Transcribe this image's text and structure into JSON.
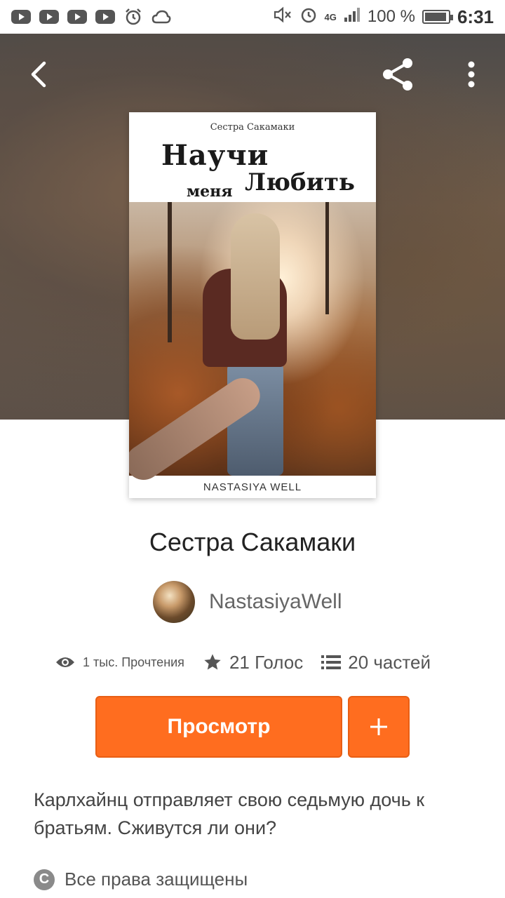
{
  "status_bar": {
    "battery": "100 %",
    "network": "4G",
    "time": "6:31"
  },
  "header": {
    "back_icon": "chevron-left-icon",
    "share_icon": "share-icon",
    "more_icon": "more-vertical-icon"
  },
  "cover": {
    "series": "Сестра Сакамаки",
    "title_line1": "Научи",
    "title_small": "меня",
    "title_line2": "Любить",
    "author": "NASTASIYA WELL"
  },
  "story": {
    "title": "Сестра Сакамаки",
    "author": "NastasiyaWell",
    "stats": {
      "reads": "1 тыс. Прочтения",
      "votes": "21 Голос",
      "parts": "20 частей"
    },
    "read_button": "Просмотр",
    "add_button_icon": "plus-icon",
    "description": "Карлхайнц отправляет свою седьмую дочь к братьям. Сживутся ли они?",
    "rights": "Все права защищены"
  },
  "colors": {
    "accent": "#ff6d1f",
    "text_primary": "#222222",
    "text_secondary": "#555555"
  }
}
